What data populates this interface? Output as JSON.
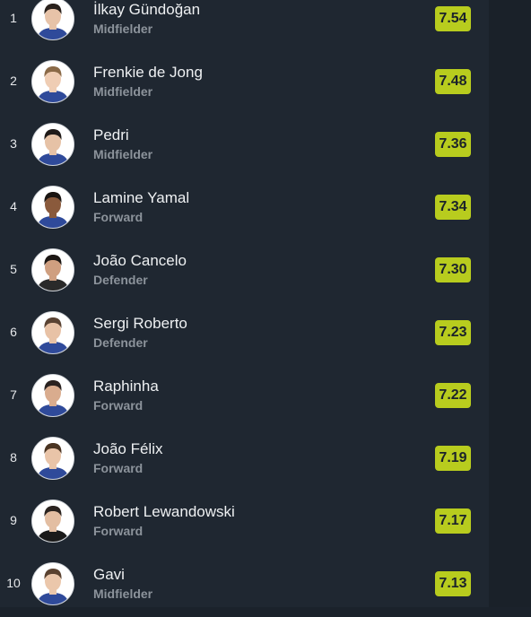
{
  "players": [
    {
      "rank": "1",
      "name": "İlkay Gündoğan",
      "position": "Midfielder",
      "rating": "7.54",
      "hair": "#2a211c",
      "skin": "#e7c3a8",
      "kit": "#2f4a9a",
      "avatar_icon": "player-portrait-icon"
    },
    {
      "rank": "2",
      "name": "Frenkie de Jong",
      "position": "Midfielder",
      "rating": "7.48",
      "hair": "#8a6a48",
      "skin": "#efcdb4",
      "kit": "#2f4a9a",
      "avatar_icon": "player-portrait-icon"
    },
    {
      "rank": "3",
      "name": "Pedri",
      "position": "Midfielder",
      "rating": "7.36",
      "hair": "#1f1a18",
      "skin": "#e6c2a6",
      "kit": "#2f4a9a",
      "avatar_icon": "player-portrait-icon"
    },
    {
      "rank": "4",
      "name": "Lamine Yamal",
      "position": "Forward",
      "rating": "7.34",
      "hair": "#1a1512",
      "skin": "#8a5a3c",
      "kit": "#2f4a9a",
      "avatar_icon": "player-portrait-icon"
    },
    {
      "rank": "5",
      "name": "João Cancelo",
      "position": "Defender",
      "rating": "7.30",
      "hair": "#1c1714",
      "skin": "#cf9f80",
      "kit": "#2a2a2a",
      "avatar_icon": "player-portrait-icon"
    },
    {
      "rank": "6",
      "name": "Sergi Roberto",
      "position": "Defender",
      "rating": "7.23",
      "hair": "#5a4333",
      "skin": "#e8c2a6",
      "kit": "#2f4a9a",
      "avatar_icon": "player-portrait-icon"
    },
    {
      "rank": "7",
      "name": "Raphinha",
      "position": "Forward",
      "rating": "7.22",
      "hair": "#2a2220",
      "skin": "#d9ac8e",
      "kit": "#2f4a9a",
      "avatar_icon": "player-portrait-icon"
    },
    {
      "rank": "8",
      "name": "João Félix",
      "position": "Forward",
      "rating": "7.19",
      "hair": "#4a3422",
      "skin": "#e9c4a8",
      "kit": "#2f4a9a",
      "avatar_icon": "player-portrait-icon"
    },
    {
      "rank": "9",
      "name": "Robert Lewandowski",
      "position": "Forward",
      "rating": "7.17",
      "hair": "#2b2420",
      "skin": "#e3bea2",
      "kit": "#1a1a1a",
      "avatar_icon": "player-portrait-icon"
    },
    {
      "rank": "10",
      "name": "Gavi",
      "position": "Midfielder",
      "rating": "7.13",
      "hair": "#5a4230",
      "skin": "#ebc7ab",
      "kit": "#2f4a9a",
      "avatar_icon": "player-portrait-icon"
    }
  ],
  "colors": {
    "background": "#1f2731",
    "rating_badge": "#b8cc1e",
    "primary_text": "#eef0f2",
    "secondary_text": "#8c939b"
  }
}
